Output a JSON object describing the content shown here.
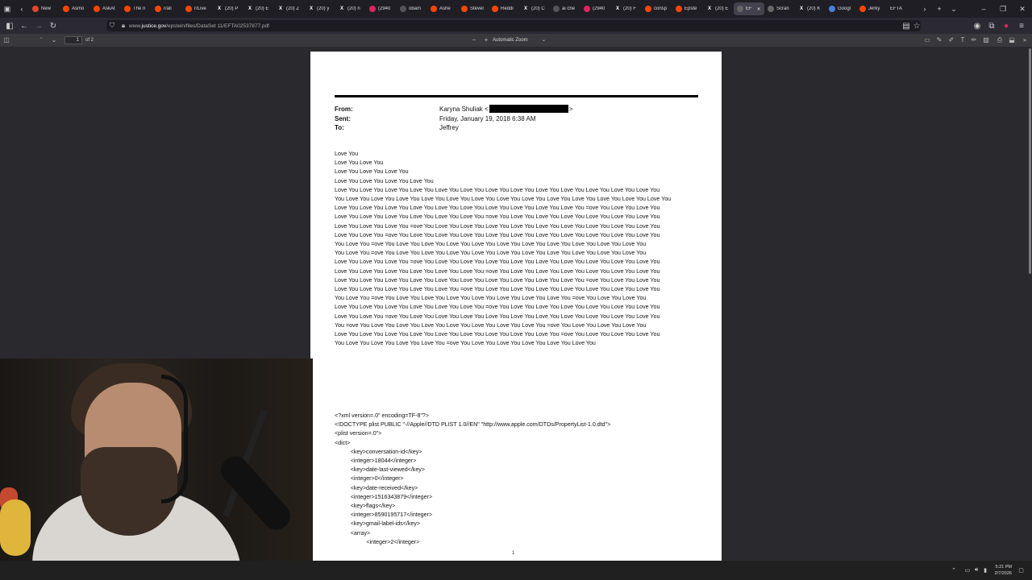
{
  "tabs": [
    {
      "label": "New",
      "icon": "firefox-icon",
      "color": "#e0462b"
    },
    {
      "label": "Asmo",
      "icon": "reddit-icon",
      "color": "#ff4500"
    },
    {
      "label": "AskAt",
      "icon": "reddit-icon",
      "color": "#ff4500"
    },
    {
      "label": "The n",
      "icon": "reddit-icon",
      "color": "#ff4500"
    },
    {
      "label": "r/all",
      "icon": "reddit-icon",
      "color": "#ff4500"
    },
    {
      "label": "r/Live",
      "icon": "reddit-icon",
      "color": "#ff4500"
    },
    {
      "label": "(20) P",
      "icon": "x-icon",
      "color": "#444"
    },
    {
      "label": "(20) E",
      "icon": "x-icon",
      "color": "#444"
    },
    {
      "label": "(20) Z",
      "icon": "x-icon",
      "color": "#444"
    },
    {
      "label": "(20) y",
      "icon": "x-icon",
      "color": "#444"
    },
    {
      "label": "(20) n",
      "icon": "x-icon",
      "color": "#444"
    },
    {
      "label": "(2940",
      "icon": "youtube-icon",
      "color": "#e0245e"
    },
    {
      "label": "obam",
      "icon": "chatgpt-icon",
      "color": "#555"
    },
    {
      "label": "Ashe",
      "icon": "reddit-icon",
      "color": "#ff4500"
    },
    {
      "label": "Stever",
      "icon": "reddit-icon",
      "color": "#ff4500"
    },
    {
      "label": "Reddi",
      "icon": "reddit-icon",
      "color": "#ff4500"
    },
    {
      "label": "(20) C",
      "icon": "x-icon",
      "color": "#444"
    },
    {
      "label": "ai che",
      "icon": "chatgpt-icon",
      "color": "#555"
    },
    {
      "label": "(2940",
      "icon": "youtube-icon",
      "color": "#e0245e"
    },
    {
      "label": "(20) F",
      "icon": "x-icon",
      "color": "#444"
    },
    {
      "label": "consp",
      "icon": "reddit-icon",
      "color": "#ff4500"
    },
    {
      "label": "Epste",
      "icon": "reddit-icon",
      "color": "#ff4500"
    },
    {
      "label": "(20) E",
      "icon": "x-icon",
      "color": "#444"
    },
    {
      "label": "EF",
      "icon": "pdf-icon",
      "color": "#666",
      "active": true
    },
    {
      "label": "Scran",
      "icon": "feather-icon",
      "color": "#666"
    },
    {
      "label": "(20) K",
      "icon": "x-icon",
      "color": "#444"
    },
    {
      "label": "Googl",
      "icon": "gemini-icon",
      "color": "#4a7fd6"
    },
    {
      "label": "Jerky",
      "icon": "reddit-icon",
      "color": "#ff4500"
    },
    {
      "label": "EFTA",
      "icon": "",
      "color": "#666"
    }
  ],
  "url": {
    "prefix": "www.",
    "domain": "justice.gov",
    "path": "/epstein/files/DataSet 11/EFTA02537877.pdf"
  },
  "pdf_toolbar": {
    "page_number": "1",
    "page_of": "of 2",
    "zoom": "Automatic Zoom"
  },
  "email": {
    "from_label": "From:",
    "from_value": "Karyna Shuliak <",
    "from_suffix": ">",
    "sent_label": "Sent:",
    "sent_value": "Friday, January 19, 2018 6:38 AM",
    "to_label": "To:",
    "to_value": "Jeffrey",
    "body_lines": [
      "Love You",
      "Love You Love You",
      "Love You Love You Love You",
      "Love You Love You Love You Love You",
      "Love You Love You Love You Love You Love You Love You Love You Love You Love You Love You Love You Love You Love You",
      "You Love You Love You Love You Love You Love You Love You Love You Love You Love You Love You Love You Love You Love You",
      "Love You Love You Love You Love You Love You Love You Love You Love You Love You Love You =ove You Love You Love You",
      "Love You Love You Love You Love You Love You Love You =ove You Love You Love You Love You Love You Love You Love You",
      "Love You Love You Love You =ove You Love You Love You Love You Love You Love You Love You Love You Love You Love You",
      "Love You Love You =ove You Love You Love You Love You Love You Love You Love You Love You Love You Love You Love You",
      "You Love You =ove You Love You Love You Love You Love You Love You Love You Love You Love You Love You Love You",
      "You Love You =ove You Love You Love You Love You Love You Love You Love You Love You Love You Love You Love You",
      "Love You Love You Love You =ove You Love You Love You Love You Love You Love You Love You Love You Love You Love You",
      "Love You Love You Love You Love You Love You Love You =ove You Love You Love You Love You Love You Love You Love You",
      "Love You Love You Love You Love You Love You Love You Love You Love You Love You Love You =ove You Love You Love You",
      "Love You Love You Love You Love You Love You =ove You Love You Love You Love You Love You Love You Love You Love You",
      "You Love You =ove You Love You Love You Love You Love You Love You Love You Love You =ove You Love You Love You",
      "Love You Love You Love You Love You Love You Love You =ove You Love You Love You Love You Love You Love You Love You",
      "Love You Love You =ove You Love You Love You Love You Love You Love You Love You Love You Love You Love You Love You",
      "You =ove You Love You Love You Love You Love You Love You Love You Love You =ove You Love You Love You Love You",
      "Love You Love You Love You Love You Love You Love You Love You Love You Love You =ove You Love You Love You Love You",
      "You Love You Love You Love You Love You =ove You Love You Love You Love You Love You Love You"
    ]
  },
  "xml_lines": [
    "<?xml version=.0\" encoding=TF-8\"?>",
    "<!DOCTYPE plist PUBLIC \"-//Apple//DTD PLIST 1.0//EN\" \"http://www.apple.com/DTDs/PropertyList-1.0.dtd\">",
    "<plist version=.0\">",
    "<dict>",
    "          <key>conversation-id</key>",
    "          <integer>18044</integer>",
    "          <key>date-last-viewed</key>",
    "          <integer>0</integer>",
    "          <key>date-received</key>",
    "          <integer>1516343879</integer>",
    "          <key>flags</key>",
    "          <integer>8590195717</integer>",
    "          <key>gmail-label-ids</key>",
    "          <array>",
    "                    <integer>2</integer>"
  ],
  "page_footer": "1",
  "clock": {
    "time": "5:21 PM",
    "date": "2/7/2026"
  }
}
